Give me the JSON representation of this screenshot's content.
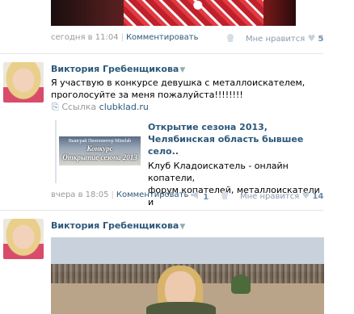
{
  "post1": {
    "time": "сегодня в 11:04",
    "comment_label": "Комментировать",
    "like_label": "Мне нравится",
    "like_count": "5"
  },
  "post2": {
    "author": "Виктория Гребенщикова",
    "text_line1": "Я участвую в конкурсе девушка с металлоискателем,",
    "text_line2": "проголосуйте за меня пожалуйста!!!!!!!!",
    "link_prefix": "Ссылка",
    "link_domain": "clubklad.ru",
    "thumb_line1": "Выиграй Пинпоинтер Minelab",
    "thumb_line2": "Конкурс",
    "thumb_line3": "Открытие сезона 2013",
    "att_title_1": "Открытие сезона 2013,",
    "att_title_2": "Челябинская область бывшее",
    "att_title_3": "село..",
    "att_desc_1": "Клуб Кладоискатель - онлайн копатели,",
    "att_desc_2": "форум копателей, металлоискатели и",
    "time": "вчера в 18:05",
    "comment_label": "Комментировать",
    "share_count": "1",
    "like_label": "Мне нравится",
    "like_count": "14"
  },
  "post3": {
    "author": "Виктория Гребенщикова"
  }
}
